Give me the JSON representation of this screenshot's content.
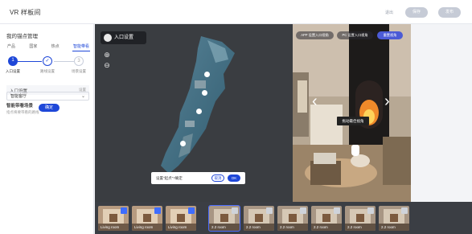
{
  "app": {
    "title": "VR 样板间"
  },
  "top": {
    "link": "退出",
    "btn1": "保存",
    "btn2": "发布"
  },
  "left": {
    "title": "我的锚点管理",
    "tabs": [
      "产品",
      "国家",
      "热点",
      "智能带看"
    ],
    "steps": [
      {
        "num": "1",
        "label": "入口设置"
      },
      {
        "num": "✓",
        "label": "路线设置"
      },
      {
        "num": "3",
        "label": "场景设置"
      }
    ],
    "entry_label": "入口设置",
    "entry_hint": "设置",
    "smart_title": "智能带看场景",
    "smart_hint": "指点将要带看的路线",
    "select_value": "智能客厅",
    "confirm": "确定"
  },
  "map": {
    "badge": "入口设置",
    "zoom_in": "⊕",
    "zoom_out": "⊖",
    "tip_text": "设置\"起点\"?确定",
    "tip_cancel": "取消",
    "tip_ok": "OK"
  },
  "pano": {
    "btn_app": "APP 设置入口视角",
    "btn_pc": "PC 设置入口视角",
    "btn_reset": "重置视角",
    "tooltip": "拖动最佳视角"
  },
  "thumbs": [
    {
      "label": "Living room",
      "icon": "vr-blue"
    },
    {
      "label": "Living room",
      "icon": "vr-blue"
    },
    {
      "label": "Living room",
      "icon": "vr-blue"
    },
    {
      "label": "2.2 room",
      "icon": "vr-gray"
    },
    {
      "label": "2.2 room",
      "icon": "vr-gray"
    },
    {
      "label": "2.2 room",
      "icon": "vr-gray"
    },
    {
      "label": "2.2 room",
      "icon": "vr-gray"
    },
    {
      "label": "2.2 room",
      "icon": "vr-gray"
    },
    {
      "label": "2.2 room",
      "icon": "vr-gray"
    }
  ]
}
